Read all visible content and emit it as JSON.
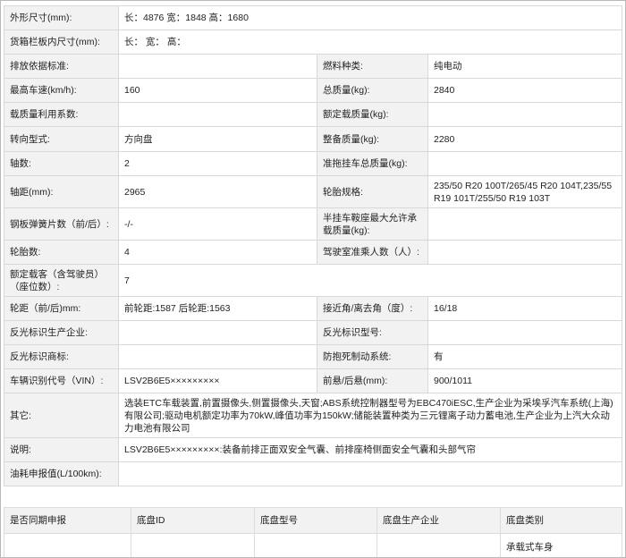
{
  "spec": {
    "outer_dims_label": "外形尺寸(mm):",
    "outer_dims_value": "长：4876 宽：1848 高：1680",
    "cargo_dims_label": "货箱栏板内尺寸(mm):",
    "cargo_dims_value": "长： 宽： 高：",
    "emission_label": "排放依据标准:",
    "emission_value": "",
    "fuel_label": "燃料种类:",
    "fuel_value": "纯电动",
    "max_speed_label": "最高车速(km/h):",
    "max_speed_value": "160",
    "total_mass_label": "总质量(kg):",
    "total_mass_value": "2840",
    "load_coeff_label": "载质量利用系数:",
    "load_coeff_value": "",
    "rated_load_label": "额定载质量(kg):",
    "rated_load_value": "",
    "steering_label": "转向型式:",
    "steering_value": "方向盘",
    "curb_mass_label": "整备质量(kg):",
    "curb_mass_value": "2280",
    "axles_label": "轴数:",
    "axles_value": "2",
    "trailer_mass_label": "准拖挂车总质量(kg):",
    "trailer_mass_value": "",
    "wheelbase_label": "轴距(mm):",
    "wheelbase_value": "2965",
    "tire_spec_label": "轮胎规格:",
    "tire_spec_value": "235/50 R20 100T/265/45 R20 104T,235/55 R19 101T/255/50 R19 103T",
    "leaf_spring_label": "钢板弹簧片数（前/后）:",
    "leaf_spring_value": "-/-",
    "saddle_load_label": "半挂车鞍座最大允许承载质量(kg):",
    "saddle_load_value": "",
    "tire_count_label": "轮胎数:",
    "tire_count_value": "4",
    "cab_passengers_label": "驾驶室准乘人数（人）:",
    "cab_passengers_value": "",
    "seats_label": "额定载客（含驾驶员）（座位数）:",
    "seats_value": "7",
    "track_label": "轮距（前/后)mm:",
    "track_value": "前轮距:1587 后轮距:1563",
    "approach_label": "接近角/离去角（度）:",
    "approach_value": "16/18",
    "reflective_maker_label": "反光标识生产企业:",
    "reflective_maker_value": "",
    "reflective_model_label": "反光标识型号:",
    "reflective_model_value": "",
    "reflective_brand_label": "反光标识商标:",
    "reflective_brand_value": "",
    "abs_label": "防抱死制动系统:",
    "abs_value": "有",
    "vin_label": "车辆识别代号（VIN）:",
    "vin_value": "LSV2B6E5×××××××××",
    "overhang_label": "前悬/后悬(mm):",
    "overhang_value": "900/1011",
    "other_label": "其它:",
    "other_value": "选装ETC车载装置,前置摄像头,侧置摄像头,天窗;ABS系统控制器型号为EBC470iESC,生产企业为采埃孚汽车系统(上海)有限公司;驱动电机额定功率为70kW,峰值功率为150kW;储能装置种类为三元锂离子动力蓄电池,生产企业为上汽大众动力电池有限公司",
    "notes_label": "说明:",
    "notes_value": "LSV2B6E5×××××××××:装备前排正面双安全气囊、前排座椅侧面安全气囊和头部气帘",
    "fuel_consumption_label": "油耗申报值(L/100km):",
    "fuel_consumption_value": ""
  },
  "chassis": {
    "headers": [
      "是否同期申报",
      "底盘ID",
      "底盘型号",
      "底盘生产企业",
      "底盘类别"
    ],
    "row": [
      "",
      "",
      "",
      "",
      "承载式车身"
    ]
  }
}
